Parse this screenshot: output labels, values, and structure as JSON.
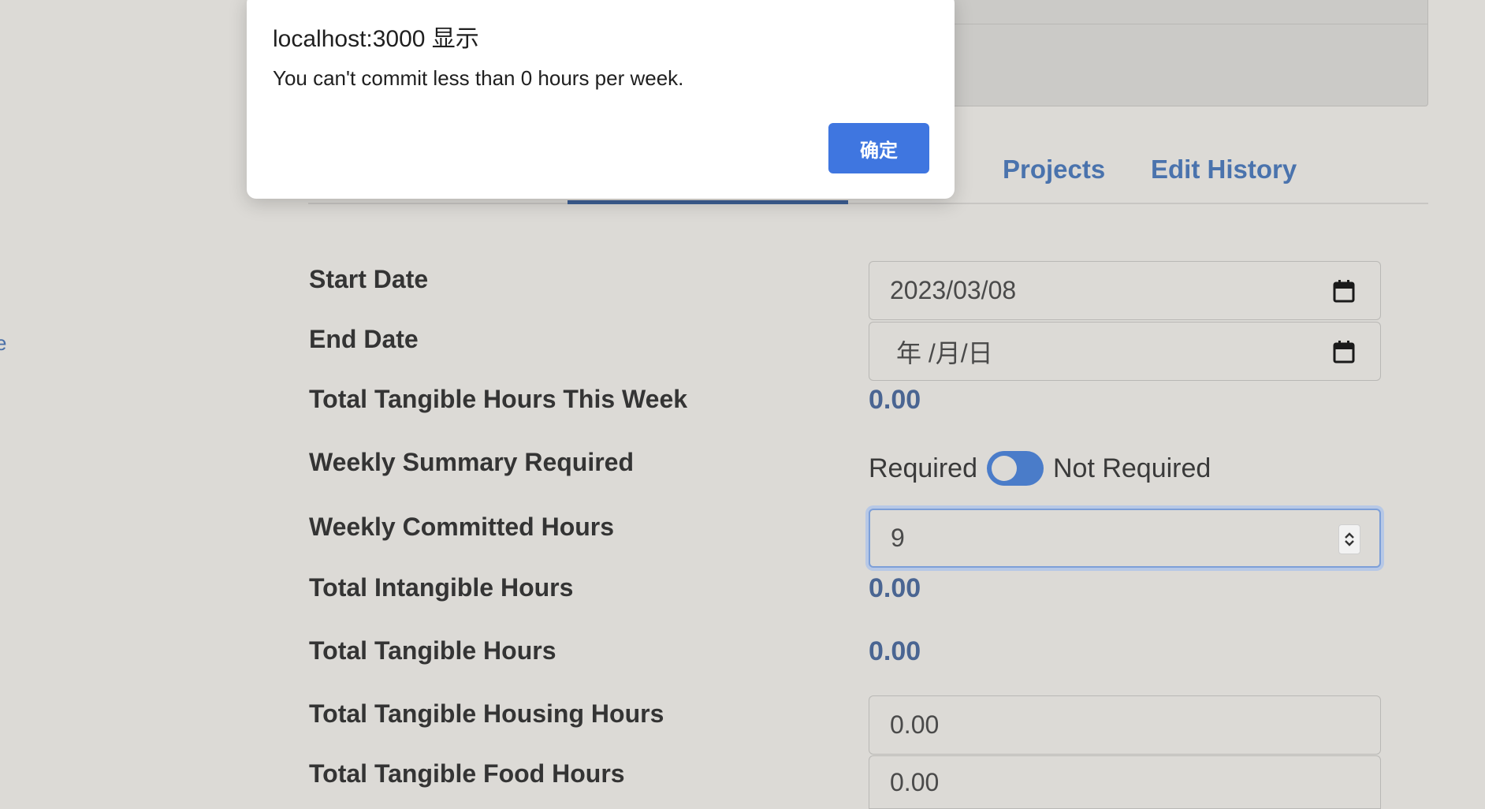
{
  "left_link": "e",
  "tabs": [
    {
      "label": "Projects"
    },
    {
      "label": "Edit History"
    }
  ],
  "form": {
    "start_date": {
      "label": "Start Date",
      "value": "2023/03/08"
    },
    "end_date": {
      "label": "End Date",
      "placeholder": "年 /月/日"
    },
    "total_tangible_hours_this_week": {
      "label": "Total Tangible Hours This Week",
      "value": "0.00"
    },
    "weekly_summary_required": {
      "label": "Weekly Summary Required",
      "left": "Required",
      "right": "Not Required"
    },
    "weekly_committed_hours": {
      "label": "Weekly Committed Hours",
      "value": "9"
    },
    "total_intangible_hours": {
      "label": "Total Intangible Hours",
      "value": "0.00"
    },
    "total_tangible_hours": {
      "label": "Total Tangible Hours",
      "value": "0.00"
    },
    "total_tangible_housing_hours": {
      "label": "Total Tangible Housing Hours",
      "value": "0.00"
    },
    "total_tangible_food_hours": {
      "label": "Total Tangible Food Hours",
      "value": "0.00"
    }
  },
  "dialog": {
    "title": "localhost:3000 显示",
    "message": "You can't commit less than 0 hours per week.",
    "ok_label": "确定"
  },
  "colors": {
    "accent": "#4a73ad",
    "button": "#3f76e0",
    "toggle": "#4a7cc9"
  }
}
